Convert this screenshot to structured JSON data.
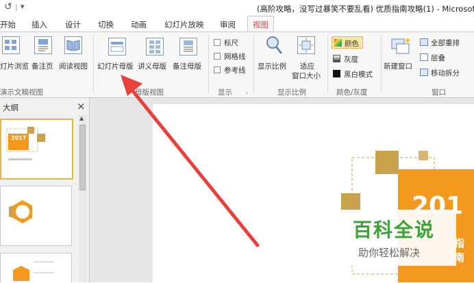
{
  "titlebar": {
    "undo_icon": "undo-icon",
    "qat_separator": "|",
    "qat_dropdown": "▾",
    "title": "(高阶攻略，没写过暴笑不要乱看) 优质指南攻略(1) - Microsof"
  },
  "tabs": [
    {
      "label": "开始"
    },
    {
      "label": "插入"
    },
    {
      "label": "设计"
    },
    {
      "label": "切换"
    },
    {
      "label": "动画"
    },
    {
      "label": "幻灯片放映"
    },
    {
      "label": "审阅"
    },
    {
      "label": "视图",
      "active": true
    }
  ],
  "ribbon": {
    "presentation_views": {
      "buttons": [
        {
          "label": "灯片浏览",
          "icon": "slide-sorter-icon"
        },
        {
          "label": "备注页",
          "icon": "notes-page-icon"
        },
        {
          "label": "阅读视图",
          "icon": "reading-view-icon"
        }
      ],
      "group_label": "演示文稿视图"
    },
    "master_views": {
      "buttons": [
        {
          "label": "幻灯片母版",
          "icon": "slide-master-icon"
        },
        {
          "label": "讲义母版",
          "icon": "handout-master-icon"
        },
        {
          "label": "备注母版",
          "icon": "notes-master-icon"
        }
      ],
      "group_label": "母版视图"
    },
    "show": {
      "checkboxes": [
        {
          "label": "标尺",
          "checked": false
        },
        {
          "label": "网格线",
          "checked": false
        },
        {
          "label": "参考线",
          "checked": false
        }
      ],
      "group_label": "显示"
    },
    "zoom": {
      "zoom_label": "显示比例",
      "fit_label_line1": "适应",
      "fit_label_line2": "窗口大小",
      "group_label": "显示比例"
    },
    "color": {
      "items": [
        {
          "label": "颜色",
          "selected": true
        },
        {
          "label": "灰度"
        },
        {
          "label": "黑白模式"
        }
      ],
      "group_label": "颜色/灰度"
    },
    "window": {
      "new_window_label": "新建窗口",
      "items": [
        {
          "label": "全部重排"
        },
        {
          "label": "层叠"
        },
        {
          "label": "移动拆分"
        }
      ],
      "group_label": "窗口"
    }
  },
  "leftpane": {
    "header": "大纲",
    "close": "×",
    "thumb1_year": "2017"
  },
  "slide": {
    "big_text": "201",
    "side_text": "指南"
  },
  "watermark": {
    "title": "百科全说",
    "subtitle": "助你轻松解决"
  },
  "colors": {
    "accent_orange": "#f39a1e",
    "gold": "#c9a24d",
    "arrow_red": "#e8403a",
    "watermark_green": "#3aa236"
  }
}
